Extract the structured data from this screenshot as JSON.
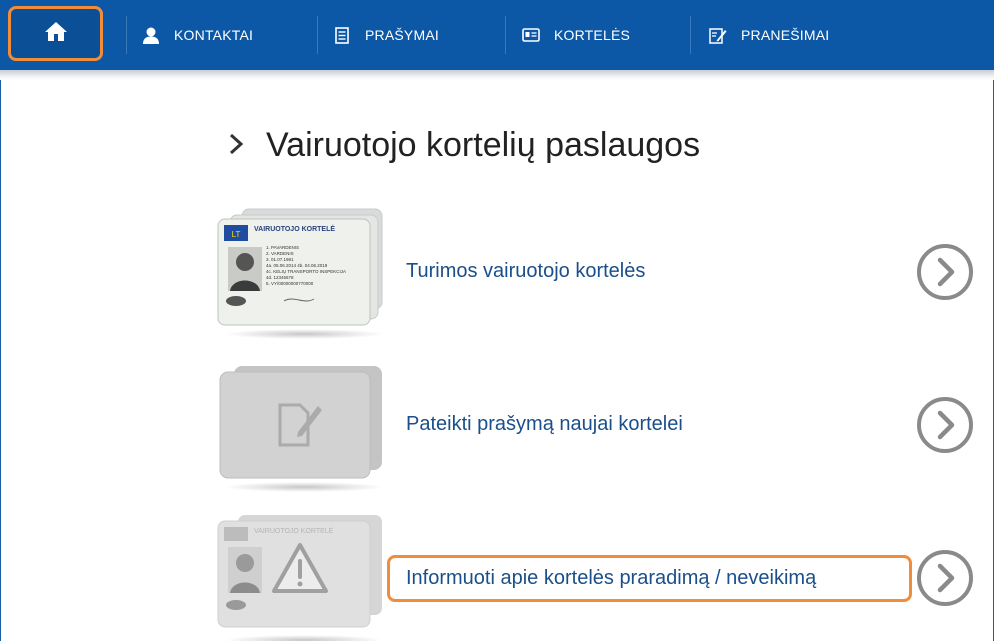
{
  "nav": {
    "home_icon": "home-icon",
    "items": [
      {
        "label": "KONTAKTAI",
        "icon": "person-icon"
      },
      {
        "label": "PRAŠYMAI",
        "icon": "document-icon"
      },
      {
        "label": "KORTELĖS",
        "icon": "id-card-icon"
      },
      {
        "label": "PRANEŠIMAI",
        "icon": "edit-note-icon"
      }
    ]
  },
  "page": {
    "title": "Vairuotojo kortelių paslaugos"
  },
  "services": [
    {
      "label": "Turimos vairuotojo kortelės",
      "image": "driver-card-image"
    },
    {
      "label": "Pateikti prašymą naujai kortelei",
      "image": "blank-card-image"
    },
    {
      "label": "Informuoti apie kortelės praradimą / neveikimą",
      "image": "warning-card-image"
    }
  ],
  "card_text": {
    "header": "VAIRUOTOJO KORTELĖ",
    "country": "LT",
    "lines": [
      "1. PAVARDENIS",
      "2. VARDENIS",
      "3. 01.07.1981",
      "4a. 05.06.2014  4b. 04.06.2019",
      "4c. KELIŲ TRANSPORTO INSPEKCIJA",
      "4d. 12345678",
      "5. VY/00000000770000"
    ]
  },
  "colors": {
    "nav_bg": "#0d58a6",
    "highlight": "#ef8d3a",
    "link": "#1b4f8a"
  }
}
